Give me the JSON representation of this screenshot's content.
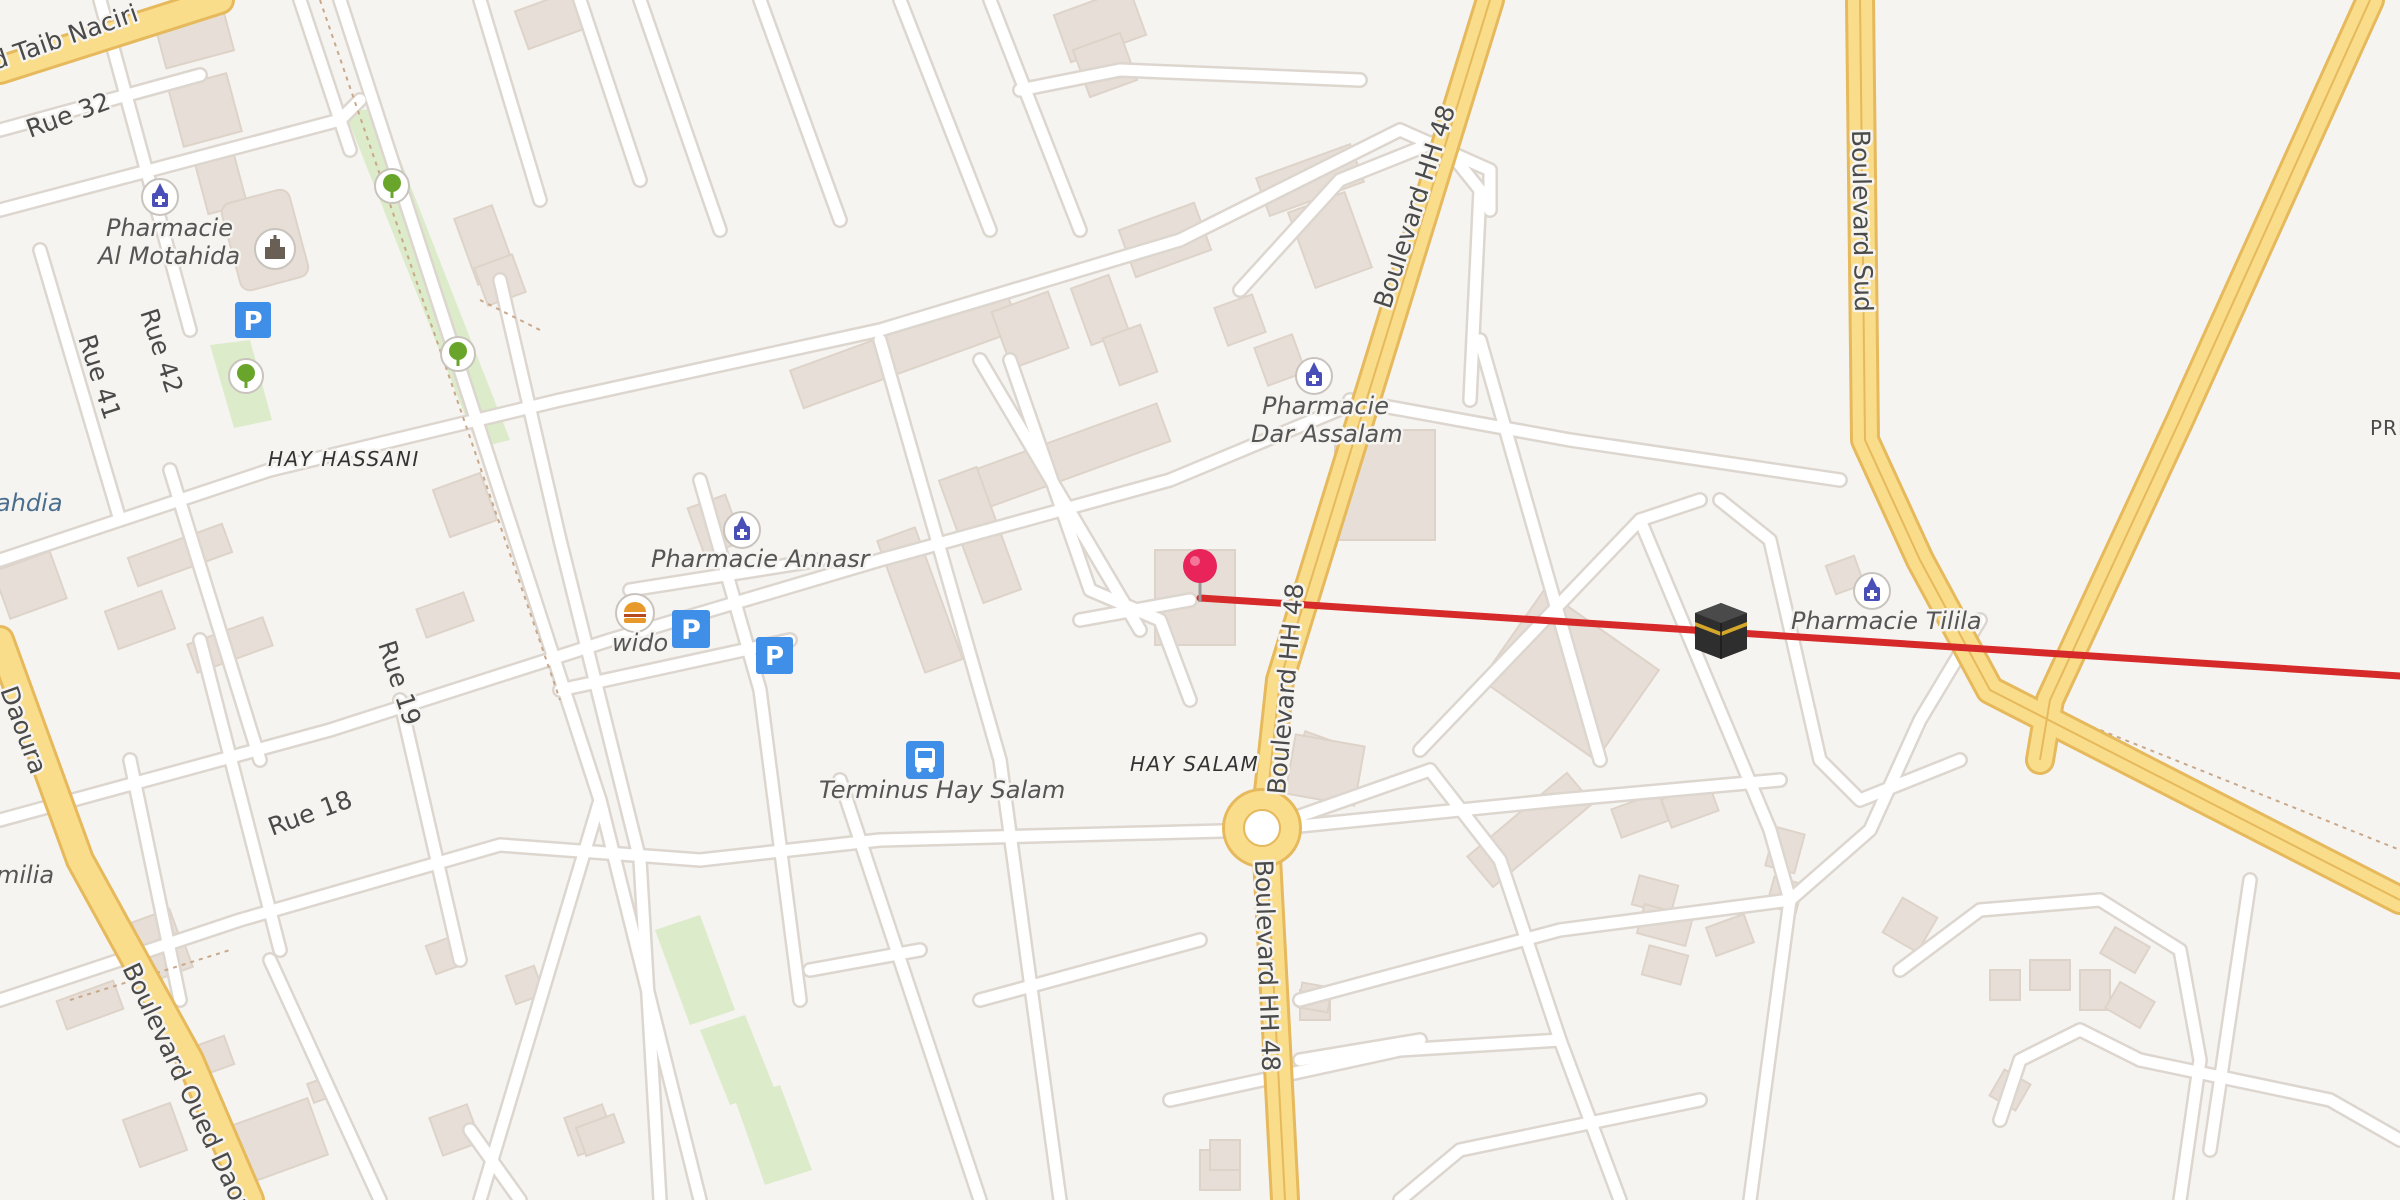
{
  "streets": {
    "taib_naciri": "d Taib Naciri",
    "rue_32": "Rue 32",
    "rue_42": "Rue 42",
    "rue_41": "Rue 41",
    "rue_19": "Rue 19",
    "rue_18": "Rue 18",
    "boulevard_hh48_upper": "Boulevard HH 48",
    "boulevard_hh48_mid": "Boulevard HH 48",
    "boulevard_hh48_lower": "Boulevard HH 48",
    "boulevard_sud": "Boulevard Sud",
    "boulevard_oued_daoura": "Boulevard Oued Daoura",
    "daoura_fragment": "Daoura",
    "left_fragment_ahdia": "ahdia",
    "left_fragment_milia": "milia",
    "right_fragment": "PRI"
  },
  "districts": {
    "hay_hassani": "HAY HASSANI",
    "hay_salam": "HAY SALAM"
  },
  "pois": {
    "pharmacie_al_motahida_line1": "Pharmacie",
    "pharmacie_al_motahida_line2": "Al Motahida",
    "pharmacie_dar_assalam_line1": "Pharmacie",
    "pharmacie_dar_assalam_line2": "Dar Assalam",
    "pharmacie_annasr": "Pharmacie Annasr",
    "wido": "wido",
    "terminus_hay_salam": "Terminus Hay Salam",
    "pharmacie_tilila": "Pharmacie Tilila"
  },
  "icons": {
    "pharmacy": "pharmacy-icon",
    "parking": "parking-icon",
    "park": "tree-icon",
    "mosque_marker": "kaaba-icon",
    "bus": "bus-stop-icon",
    "fast_food": "fast-food-icon",
    "place_of_worship": "place-of-worship-icon",
    "location_pin": "location-pin-icon"
  },
  "parking_letter": "P",
  "colors": {
    "background": "#f6f4f1",
    "road_major_fill": "#f9dd8a",
    "road_major_casing": "#e6b95c",
    "road_minor": "#ffffff",
    "building": "#e7dfd7",
    "park": "#dcebc9",
    "qibla_line": "#d62a2a",
    "pin": "#e8245a",
    "pharmacy_badge": "#4a4fb8",
    "parking_badge": "#3f8fe8"
  }
}
